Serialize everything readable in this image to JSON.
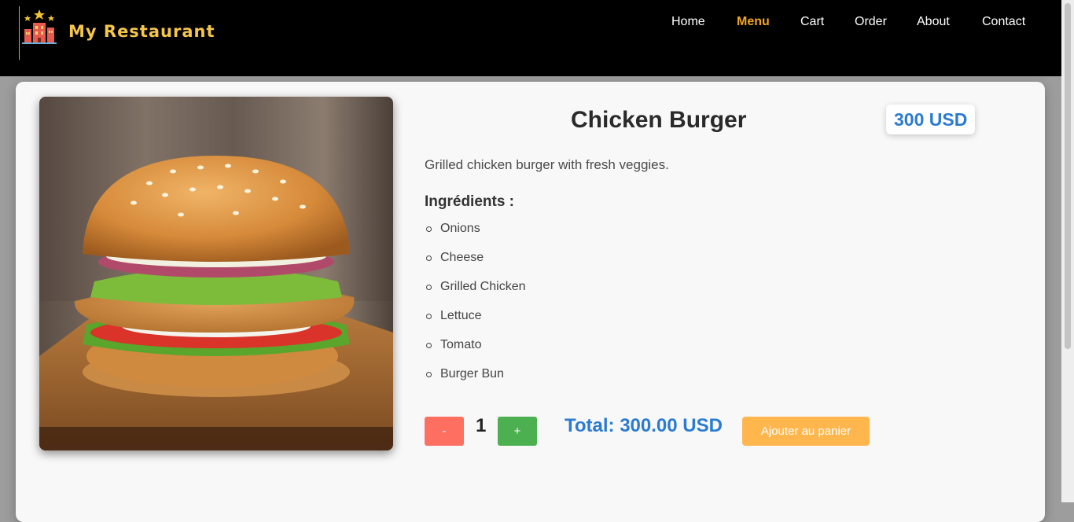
{
  "brand": {
    "name": "My Restaurant",
    "logo_icon": "restaurant-building-icon"
  },
  "nav": {
    "items": [
      {
        "label": "Home",
        "active": false
      },
      {
        "label": "Menu",
        "active": true
      },
      {
        "label": "Cart",
        "active": false
      },
      {
        "label": "Order",
        "active": false
      },
      {
        "label": "About",
        "active": false
      },
      {
        "label": "Contact",
        "active": false
      }
    ]
  },
  "product": {
    "name": "Chicken Burger",
    "price": "300 USD",
    "description": "Grilled chicken burger with fresh veggies.",
    "ingredients_title": "Ingrédients :",
    "ingredients": [
      "Onions",
      "Cheese",
      "Grilled Chicken",
      "Lettuce",
      "Tomato",
      "Burger Bun"
    ],
    "image_icon": "chicken-burger-image"
  },
  "cart": {
    "minus_label": "-",
    "plus_label": "+",
    "quantity": "1",
    "total": "Total: 300.00 USD",
    "add_label": "Ajouter au panier"
  },
  "colors": {
    "header_bg": "#000000",
    "active_nav": "#f2a61c",
    "brand": "#f6c64a",
    "price": "#2b7bd1",
    "minus": "#ff6f61",
    "plus": "#4caf50",
    "add_to_cart": "#ffb74d"
  }
}
